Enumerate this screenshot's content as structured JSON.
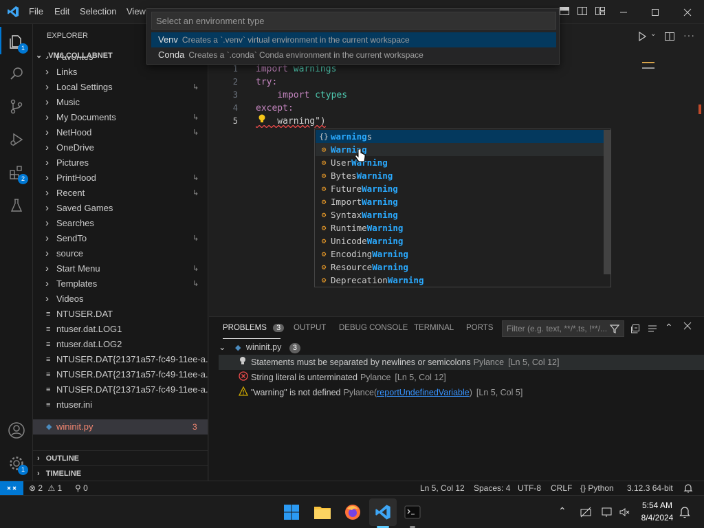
{
  "titlebar": {
    "menus": [
      "File",
      "Edit",
      "Selection",
      "View"
    ]
  },
  "quickpick": {
    "placeholder": "Select an environment type",
    "items": [
      {
        "name": "Venv",
        "description": "Creates a `.venv` virtual environment in the current workspace"
      },
      {
        "name": "Conda",
        "description": "Creates a `.conda` Conda environment in the current workspace"
      }
    ]
  },
  "activity": {
    "explorer_badge": "1",
    "extensions_badge": "2",
    "manage_badge": "1"
  },
  "explorer": {
    "title": "EXPLORER",
    "root": "VM6.COLLABNET",
    "items": [
      {
        "label": "Favorites",
        "type": "folder",
        "link": false
      },
      {
        "label": "Links",
        "type": "folder",
        "link": false
      },
      {
        "label": "Local Settings",
        "type": "folder",
        "link": true
      },
      {
        "label": "Music",
        "type": "folder",
        "link": false
      },
      {
        "label": "My Documents",
        "type": "folder",
        "link": true
      },
      {
        "label": "NetHood",
        "type": "folder",
        "link": true
      },
      {
        "label": "OneDrive",
        "type": "folder",
        "link": false
      },
      {
        "label": "Pictures",
        "type": "folder",
        "link": false
      },
      {
        "label": "PrintHood",
        "type": "folder",
        "link": true
      },
      {
        "label": "Recent",
        "type": "folder",
        "link": true
      },
      {
        "label": "Saved Games",
        "type": "folder",
        "link": false
      },
      {
        "label": "Searches",
        "type": "folder",
        "link": false
      },
      {
        "label": "SendTo",
        "type": "folder",
        "link": true
      },
      {
        "label": "source",
        "type": "folder",
        "link": false
      },
      {
        "label": "Start Menu",
        "type": "folder",
        "link": true
      },
      {
        "label": "Templates",
        "type": "folder",
        "link": true
      },
      {
        "label": "Videos",
        "type": "folder",
        "link": false
      },
      {
        "label": "NTUSER.DAT",
        "type": "file",
        "link": false
      },
      {
        "label": "ntuser.dat.LOG1",
        "type": "file",
        "link": false
      },
      {
        "label": "ntuser.dat.LOG2",
        "type": "file",
        "link": false
      },
      {
        "label": "NTUSER.DAT{21371a57-fc49-11ee-a...",
        "type": "file",
        "link": false
      },
      {
        "label": "NTUSER.DAT{21371a57-fc49-11ee-a...",
        "type": "file",
        "link": false
      },
      {
        "label": "NTUSER.DAT{21371a57-fc49-11ee-a...",
        "type": "file",
        "link": false
      },
      {
        "label": "ntuser.ini",
        "type": "file",
        "link": false
      }
    ],
    "active_file": "wininit.py",
    "active_file_count": "3",
    "outline": "OUTLINE",
    "timeline": "TIMELINE"
  },
  "editor": {
    "lines": [
      {
        "num": "1",
        "tokens": [
          {
            "t": "import ",
            "c": "kw"
          },
          {
            "t": "warnings",
            "c": "mod"
          }
        ]
      },
      {
        "num": "2",
        "tokens": [
          {
            "t": "try:",
            "c": "kw"
          }
        ]
      },
      {
        "num": "3",
        "tokens": [
          {
            "t": "    import ",
            "c": "kw"
          },
          {
            "t": "ctypes",
            "c": "mod"
          }
        ]
      },
      {
        "num": "4",
        "tokens": [
          {
            "t": "except:",
            "c": "kw"
          }
        ]
      },
      {
        "num": "5",
        "tokens": [
          {
            "t": "    warning\")",
            "c": "plain"
          }
        ]
      }
    ]
  },
  "suggest": {
    "items": [
      {
        "icon": "{}",
        "pre": "",
        "hl": "warning",
        "post": "s",
        "kind": "module"
      },
      {
        "icon": "⚙",
        "pre": "",
        "hl": "Warning",
        "post": "",
        "kind": "class"
      },
      {
        "icon": "⚙",
        "pre": "User",
        "hl": "Warning",
        "post": "",
        "kind": "class"
      },
      {
        "icon": "⚙",
        "pre": "Bytes",
        "hl": "Warning",
        "post": "",
        "kind": "class"
      },
      {
        "icon": "⚙",
        "pre": "Future",
        "hl": "Warning",
        "post": "",
        "kind": "class"
      },
      {
        "icon": "⚙",
        "pre": "Import",
        "hl": "Warning",
        "post": "",
        "kind": "class"
      },
      {
        "icon": "⚙",
        "pre": "Syntax",
        "hl": "Warning",
        "post": "",
        "kind": "class"
      },
      {
        "icon": "⚙",
        "pre": "Runtime",
        "hl": "Warning",
        "post": "",
        "kind": "class"
      },
      {
        "icon": "⚙",
        "pre": "Unicode",
        "hl": "Warning",
        "post": "",
        "kind": "class"
      },
      {
        "icon": "⚙",
        "pre": "Encoding",
        "hl": "Warning",
        "post": "",
        "kind": "class"
      },
      {
        "icon": "⚙",
        "pre": "Resource",
        "hl": "Warning",
        "post": "",
        "kind": "class"
      },
      {
        "icon": "⚙",
        "pre": "Deprecation",
        "hl": "Warning",
        "post": "",
        "kind": "class"
      }
    ]
  },
  "panel": {
    "tabs": [
      "PROBLEMS",
      "OUTPUT",
      "DEBUG CONSOLE",
      "TERMINAL",
      "PORTS"
    ],
    "problems_count": "3",
    "filter_placeholder": "Filter (e.g. text, **/*.ts, !**/...",
    "file": "wininit.py",
    "file_count": "3",
    "problems": [
      {
        "severity": "info",
        "message": "Statements must be separated by newlines or semicolons",
        "source": "Pylance",
        "link": "",
        "location": "[Ln 5, Col 12]"
      },
      {
        "severity": "error",
        "message": "String literal is unterminated",
        "source": "Pylance",
        "link": "",
        "location": "[Ln 5, Col 12]"
      },
      {
        "severity": "warning",
        "message": "\"warning\" is not defined",
        "source": "Pylance",
        "link": "reportUndefinedVariable",
        "location": "[Ln 5, Col 5]"
      }
    ]
  },
  "statusbar": {
    "errors": "2",
    "warnings": "1",
    "ports": "0",
    "position": "Ln 5, Col 12",
    "spaces": "Spaces: 4",
    "encoding": "UTF-8",
    "eol": "CRLF",
    "language": "Python",
    "interpreter": "3.12.3 64-bit"
  },
  "taskbar": {
    "time": "5:54 AM",
    "date": "8/4/2024"
  },
  "colors": {
    "accent": "#0078d4",
    "selection": "#04395e",
    "highlight": "#2aaaff",
    "error": "#f14c4c",
    "warning": "#cca700"
  }
}
